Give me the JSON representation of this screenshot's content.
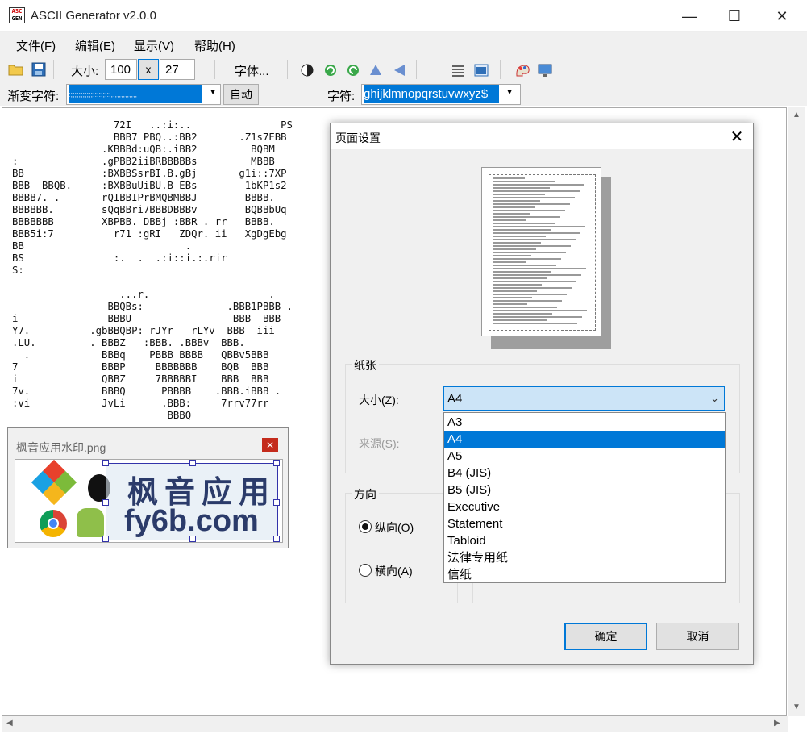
{
  "window": {
    "title": "ASCII Generator v2.0.0",
    "icon_top": "ASC",
    "icon_bottom": "GEN"
  },
  "window_controls": {
    "minimize": "—",
    "maximize": "☐",
    "close": "✕"
  },
  "menu": [
    "文件(F)",
    "编辑(E)",
    "显示(V)",
    "帮助(H)"
  ],
  "toolbar": {
    "size_label": "大小:",
    "width": "100",
    "x_label": "x",
    "height": "27",
    "font_button": "字体...",
    "gradient_label": "渐变字符:",
    "gradient_value": ":;;;;;;;;;;;;::::;;:;,,,,,,,,,,,,,",
    "auto_button": "自动",
    "chars_label": "字符:",
    "chars_value": "ghijklmnopqrstuvwxyz$"
  },
  "ascii_lines": [
    "                 72I   ..:i:..               PS",
    "                 BBB7 PBQ..:BB2       .Z1s7EBB",
    "               .KBBBd:uQB:.iBB2         BQBM",
    ":              .gPBB2iiBRBBBBBs         MBBB",
    "BB             :BXBBSsrBI.B.gBj       g1i::7XP",
    "BBB  BBQB.     :BXBBuUiBU.B EBs        1bKP1s2",
    "BBBB7. .       rQIBBIPrBMQBMBBJ        BBBB.",
    "BBBBBB.        sQqBBri7BBBDBBBv        BQBBbUq",
    "BBBBBBB        XBPBB. DBBj :BBR . rr   BBBB.",
    "BBB5i:7          r71 :gRI   ZDQr. ii   XgDgEbg",
    "BB                           .",
    "BS               :.  .  .:i::i.:.rir",
    "S:",
    "",
    "                  ...r.                    .",
    "                BBQBs:              .BBB1PBBB .",
    "i               BBBU                 BBB  BBB",
    "Y7.          .gbBBQBP: rJYr   rLYv  BBB  iii",
    ".LU.         . BBBZ   :BBB. .BBBv  BBB.",
    "  .            BBBq    PBBB BBBB   QBBv5BBB",
    "7              BBBP     BBBBBBB    BQB  BBB",
    "i              QBBZ     7BBBBBI    BBB  BBB",
    "7v.            BBBQ      PBBBB    .BBB.iBBB .",
    ":vi            JvLi      .BBB:     7rrv77rr",
    "                          BBBQ"
  ],
  "image_window": {
    "title": "枫音应用水印.png",
    "close": "✕",
    "watermark_line1": "枫音应用",
    "watermark_line2": "fy6b.com"
  },
  "dialog": {
    "title": "页面设置",
    "close": "✕",
    "paper_group": "纸张",
    "size_label": "大小(Z):",
    "size_value": "A4",
    "source_label": "来源(S):",
    "orientation_group": "方向",
    "portrait": "纵向(O)",
    "landscape": "横向(A)",
    "ok": "确定",
    "cancel": "取消",
    "size_options": [
      "A3",
      "A4",
      "A5",
      "B4 (JIS)",
      "B5 (JIS)",
      "Executive",
      "Statement",
      "Tabloid",
      "法律专用纸",
      "信纸"
    ],
    "selected_option_index": 1
  },
  "colors": {
    "accent": "#0078d7",
    "selection_bg": "#cce4f7"
  }
}
